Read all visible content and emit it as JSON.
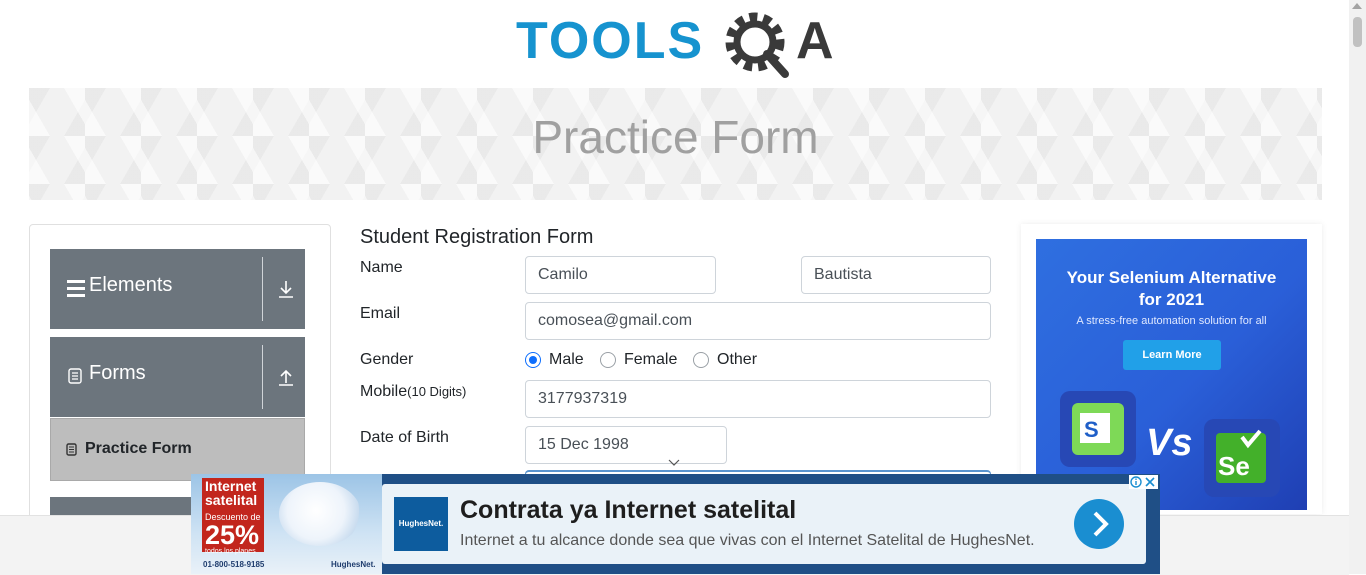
{
  "header": {
    "logo_text_left": "TOOLS",
    "logo_text_right": "A"
  },
  "banner": {
    "title": "Practice Form"
  },
  "sidebar": {
    "groups": [
      {
        "label": "Elements",
        "expanded": false
      },
      {
        "label": "Forms",
        "expanded": true
      }
    ],
    "active_item": "Practice Form"
  },
  "form": {
    "title": "Student Registration Form",
    "name_label": "Name",
    "first_name": "Camilo",
    "last_name": "Bautista",
    "email_label": "Email",
    "email": "comosea@gmail.com",
    "gender_label": "Gender",
    "gender_options": [
      "Male",
      "Female",
      "Other"
    ],
    "gender_selected": "Male",
    "mobile_label": "Mobile",
    "mobile_hint": "(10 Digits)",
    "mobile": "3177937319",
    "dob_label": "Date of Birth",
    "dob": "15 Dec 1998"
  },
  "ad_right": {
    "headline": "Your Selenium Alternative for 2021",
    "subline": "A stress-free automation solution for all",
    "button": "Learn More",
    "vs": "Vs",
    "se_text": "Se"
  },
  "ad_bottom": {
    "thumb_title": "Internet satelital",
    "thumb_discount_label": "Descuento de",
    "thumb_discount": "25%",
    "thumb_plans": "todos los planes",
    "thumb_phone": "01-800-518-9185",
    "thumb_brand": "HughesNet.",
    "logo": "HughesNet.",
    "headline": "Contrata ya Internet satelital",
    "subline": "Internet a tu alcance donde sea que vivas con el Internet Satelital de HughesNet."
  },
  "colors": {
    "brand_blue": "#1693cf",
    "sidebar_gray": "#6c757d",
    "active_item": "#bdbdbd",
    "radio_checked": "#0d6efd"
  }
}
